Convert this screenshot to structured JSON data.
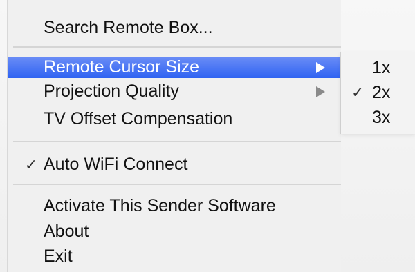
{
  "menu": {
    "items": [
      {
        "label": "Search Remote Box..."
      },
      {
        "label": "Remote Cursor Size"
      },
      {
        "label": "Projection Quality"
      },
      {
        "label": "TV Offset Compensation"
      },
      {
        "label": "Auto WiFi Connect",
        "check": "✓"
      },
      {
        "label": "Activate This Sender Software"
      },
      {
        "label": "About"
      },
      {
        "label": "Exit"
      }
    ]
  },
  "submenu": {
    "items": [
      {
        "label": "1x"
      },
      {
        "label": "2x",
        "check": "✓"
      },
      {
        "label": "3x"
      }
    ]
  },
  "colors": {
    "highlight_top": "#6b8df6",
    "highlight_bottom": "#2f63f2",
    "menu_bg": "#f0f0f0",
    "separator": "#d5d5d5"
  }
}
